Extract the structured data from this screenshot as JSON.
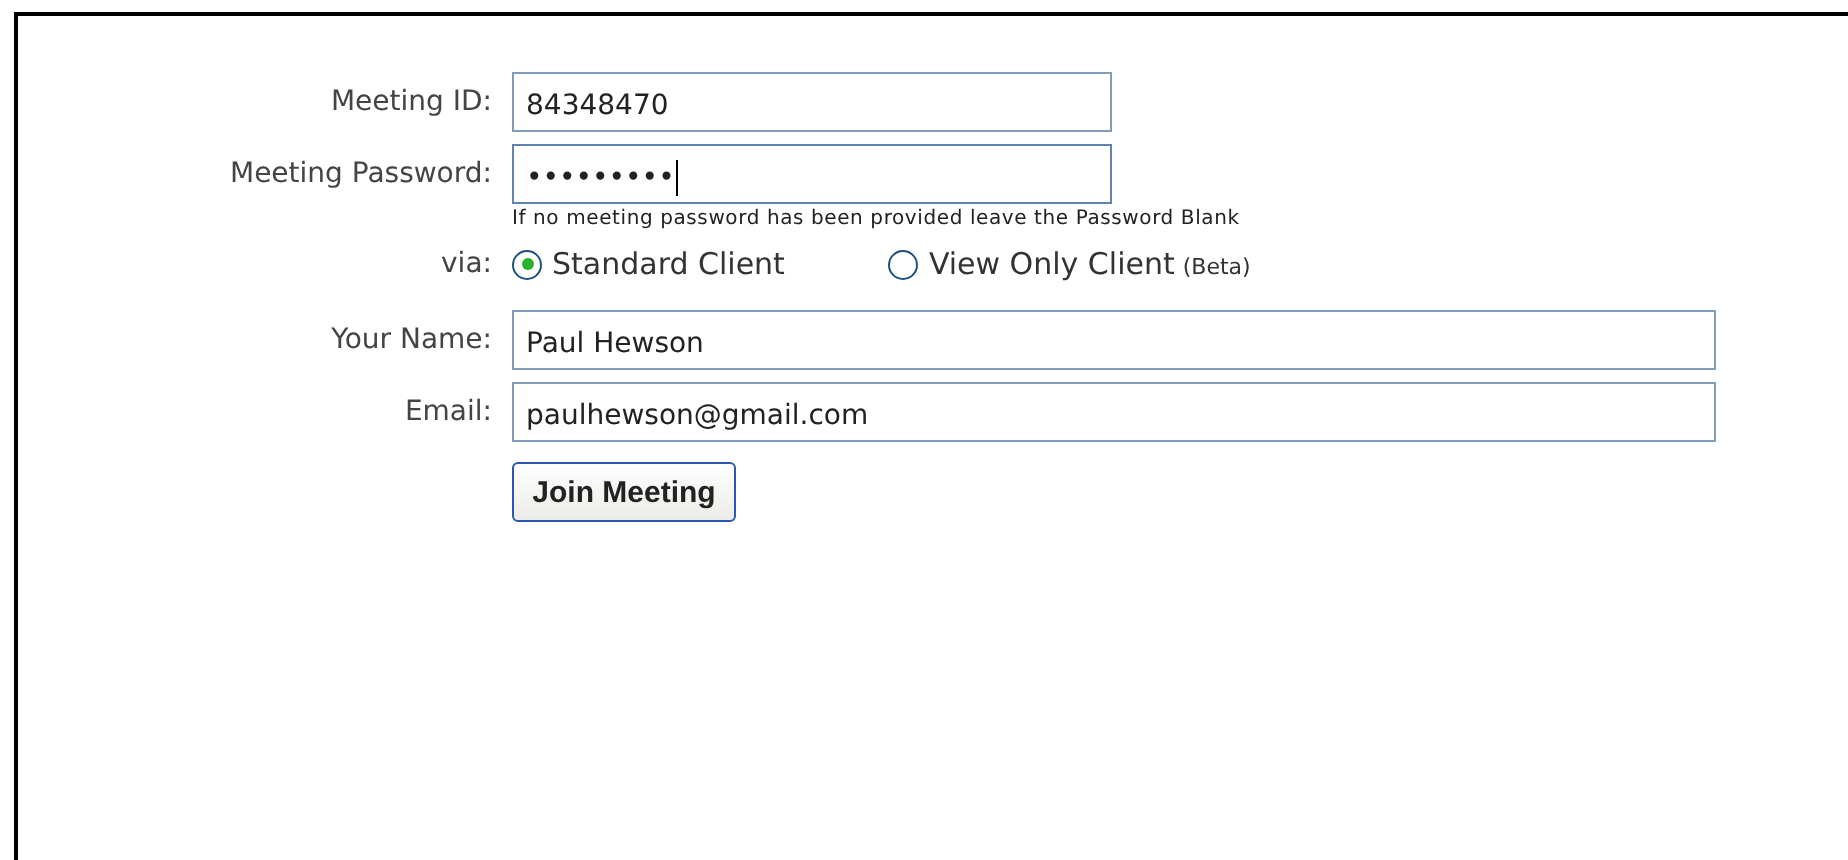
{
  "fields": [
    {
      "label": "Meeting ID:",
      "value": "84348470",
      "focused": false
    },
    {
      "label": "Meeting Password:",
      "value": "•••••••••",
      "focused": true
    }
  ],
  "hint": "If no meeting password has been provided leave the Password Blank",
  "via": {
    "label": "via:",
    "options": [
      {
        "label": "Standard Client",
        "selected": true
      },
      {
        "label": "View Only Client",
        "note": "(Beta)",
        "selected": false
      }
    ]
  },
  "contact_fields": [
    {
      "label": "Your Name:",
      "value": "Paul Hewson"
    },
    {
      "label": "Email:",
      "value": "paulhewson@gmail.com"
    }
  ],
  "button": "Join Meeting"
}
